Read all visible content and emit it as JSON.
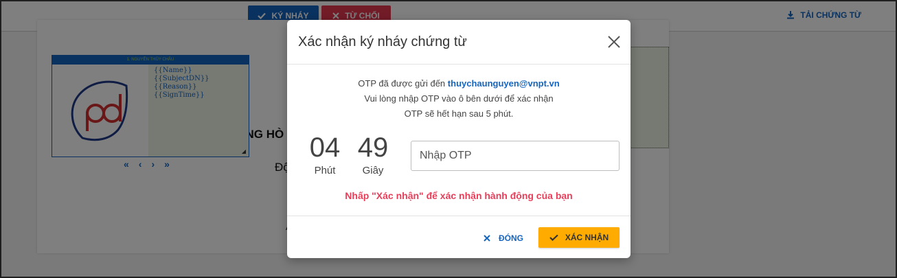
{
  "toolbar": {
    "sign_label": "KÝ NHÁY",
    "reject_label": "TỪ CHỐI",
    "download_label": "TẢI CHỨNG TỪ"
  },
  "document": {
    "signer_header": "1. NGUYỄN THỦY CHÂU",
    "placeholders": [
      "{{Name}}",
      "{{SubjectDN}}",
      "{{Reason}}",
      "{{SignTime}}"
    ],
    "heading_partial": "CỘNG HÒ",
    "line_partial": "Độ",
    "line_partial_2": "A",
    "nav_first": "«",
    "nav_prev": "‹",
    "nav_next": "›",
    "nav_last": "»"
  },
  "modal": {
    "title": "Xác nhận ký nháy chứng từ",
    "info_prefix": "OTP đã được gửi đến",
    "email": "thuychaunguyen@vnpt.vn",
    "info_line2": "Vui lòng nhập OTP vào ô bên dưới để xác nhận",
    "info_line3": "OTP sẽ hết hạn sau 5 phút.",
    "timer": {
      "minutes": "04",
      "minutes_label": "Phút",
      "seconds": "49",
      "seconds_label": "Giây"
    },
    "otp_placeholder": "Nhập OTP",
    "otp_value": "",
    "note": "Nhấp \"Xác nhận\" để xác nhận hành động của bạn",
    "close_label": "ĐÓNG",
    "confirm_label": "XÁC NHẬN"
  },
  "colors": {
    "primary": "#1565c0",
    "danger": "#e53950",
    "warning": "#ffab00",
    "note": "#e83e5a"
  },
  "icons": {
    "sign": "check-icon",
    "reject": "x-icon",
    "download": "download-icon",
    "close": "close-icon",
    "confirm": "check-icon"
  }
}
